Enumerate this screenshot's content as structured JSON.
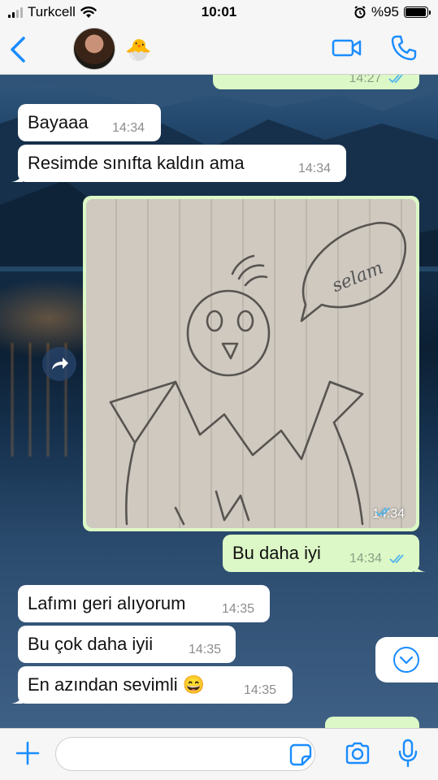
{
  "status_bar": {
    "carrier": "Turkcell",
    "time": "10:01",
    "battery": "%95",
    "battery_level": 0.95
  },
  "header": {
    "back_icon": "chevron-left-icon",
    "contact_emoji": "🐣",
    "video_icon": "video-camera-icon",
    "call_icon": "phone-icon"
  },
  "messages": [
    {
      "direction": "out",
      "text": "",
      "time": "14:27",
      "partial": true
    },
    {
      "direction": "in",
      "text": "Bayaaa",
      "time": "14:34"
    },
    {
      "direction": "in",
      "text": "Resimde sınıfta kaldın ama",
      "time": "14:34"
    },
    {
      "direction": "out",
      "type": "image",
      "image_text": "selam",
      "time": "14:34",
      "status": "read"
    },
    {
      "direction": "out",
      "text": "Bu daha iyi",
      "time": "14:34",
      "status": "read"
    },
    {
      "direction": "in",
      "text": "Lafımı geri alıyorum",
      "time": "14:35"
    },
    {
      "direction": "in",
      "text": "Bu çok daha iyii",
      "time": "14:35"
    },
    {
      "direction": "in",
      "text": "En azından sevimli 😄",
      "time": "14:35"
    }
  ],
  "colors": {
    "accent": "#1a8cff",
    "outgoing_bubble": "#dcf8c6",
    "incoming_bubble": "#ffffff",
    "read_ticks": "#4fb6ec"
  },
  "input_bar": {
    "placeholder": "",
    "value": ""
  }
}
